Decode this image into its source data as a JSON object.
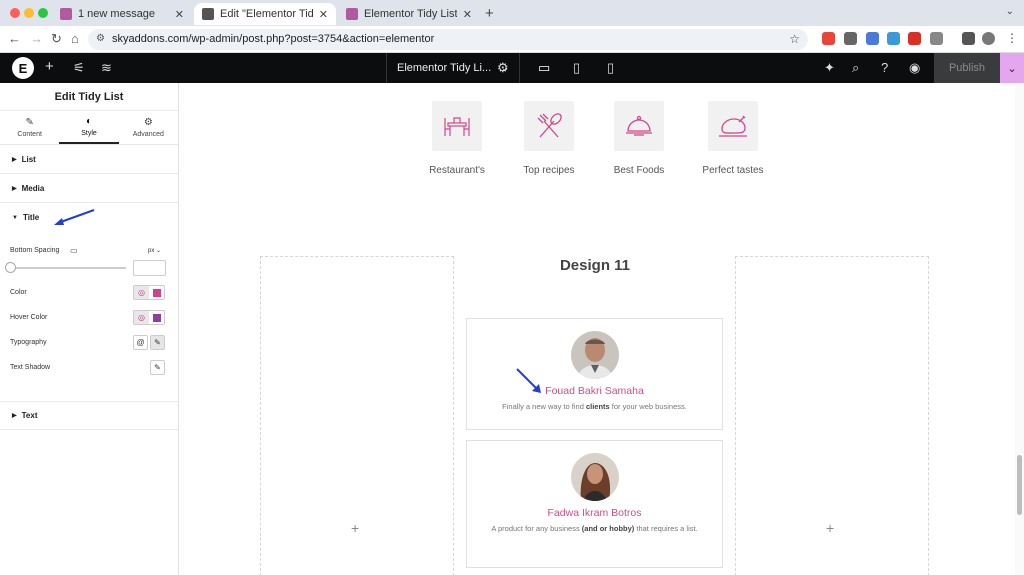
{
  "browser": {
    "tabs": [
      {
        "title": "1 new message",
        "active": false
      },
      {
        "title": "Edit \"Elementor Tidy List Wid",
        "active": true
      },
      {
        "title": "Elementor Tidy List Widget -",
        "active": false
      }
    ],
    "url": "skyaddons.com/wp-admin/post.php?post=3754&action=elementor",
    "new_tab_icon": "plus-icon",
    "tab_menu_icon": "chevron-down-icon"
  },
  "editor_bar": {
    "doc_title": "Elementor Tidy Li...",
    "publish_label": "Publish",
    "accent_color": "#e4a6ef"
  },
  "panel": {
    "title": "Edit Tidy List",
    "tabs": [
      {
        "label": "Content",
        "icon": "pencil-icon",
        "active": false
      },
      {
        "label": "Style",
        "icon": "contrast-icon",
        "active": true
      },
      {
        "label": "Advanced",
        "icon": "gear-icon",
        "active": false
      }
    ],
    "sections": {
      "list": "List",
      "media": "Media",
      "title": "Title",
      "text": "Text"
    },
    "controls": {
      "bottom_spacing": "Bottom Spacing",
      "unit": "px",
      "unit_caret": "⌄",
      "color": "Color",
      "hover_color": "Hover Color",
      "typography": "Typography",
      "text_shadow": "Text Shadow"
    },
    "colors": {
      "title_color": "#d63d8c",
      "hover_color": "#8e3fa0"
    }
  },
  "canvas": {
    "categories": [
      {
        "label": "Restaurant's",
        "icon": "restaurant-icon"
      },
      {
        "label": "Top recipes",
        "icon": "utensils-icon"
      },
      {
        "label": "Best Foods",
        "icon": "cloche-icon"
      },
      {
        "label": "Perfect tastes",
        "icon": "roast-chicken-icon"
      }
    ],
    "design_title": "Design 11",
    "cards": [
      {
        "name": "Fouad Bakri Samaha",
        "desc_before": "Finally a new way to find ",
        "desc_bold": "clients",
        "desc_after": " for your web business."
      },
      {
        "name": "Fadwa Ikram Botros",
        "desc_before": "A product for any business ",
        "desc_bold": "(and or hobby)",
        "desc_after": " that requires a list."
      }
    ],
    "add_widget": "+",
    "brand_color": "#d1488a"
  }
}
